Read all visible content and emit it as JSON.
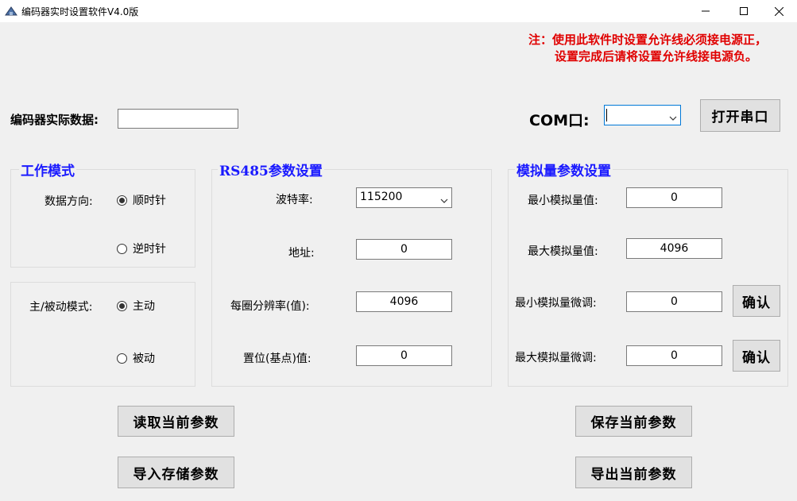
{
  "window": {
    "title": "编码器实时设置软件V4.0版",
    "icon": "app-icon"
  },
  "notice": {
    "line1": "注：使用此软件时设置允许线必须接电源正，",
    "line2": "设置完成后请将设置允许线接电源负。",
    "color": "#e00000"
  },
  "encoder_data": {
    "label": "编码器实际数据:",
    "value": ""
  },
  "com_port": {
    "label": "COM口:",
    "value": "",
    "open_button": "打开串口"
  },
  "work_mode": {
    "title": "工作模式",
    "direction_label": "数据方向:",
    "clockwise": "顺时针",
    "counterclockwise": "逆时针",
    "selected_direction": "顺时针"
  },
  "master_mode": {
    "label": "主/被动模式:",
    "active": "主动",
    "passive": "被动",
    "selected": "主动"
  },
  "rs485": {
    "title": "RS485参数设置",
    "baud_label": "波特率:",
    "baud_value": "115200",
    "address_label": "地址:",
    "address_value": "0",
    "resolution_label": "每圈分辨率(值):",
    "resolution_value": "4096",
    "preset_label": "置位(基点)值:",
    "preset_value": "0"
  },
  "analog": {
    "title": "模拟量参数设置",
    "min_label": "最小模拟量值:",
    "min_value": "0",
    "max_label": "最大模拟量值:",
    "max_value": "4096",
    "min_trim_label": "最小模拟量微调:",
    "min_trim_value": "0",
    "max_trim_label": "最大模拟量微调:",
    "max_trim_value": "0",
    "confirm": "确认"
  },
  "actions": {
    "read_current": "读取当前参数",
    "import_stored": "导入存储参数",
    "save_current": "保存当前参数",
    "export_current": "导出当前参数"
  },
  "colors": {
    "group_title": "#1a1aff",
    "background": "#f0f0f0",
    "accent": "#0078d7"
  }
}
